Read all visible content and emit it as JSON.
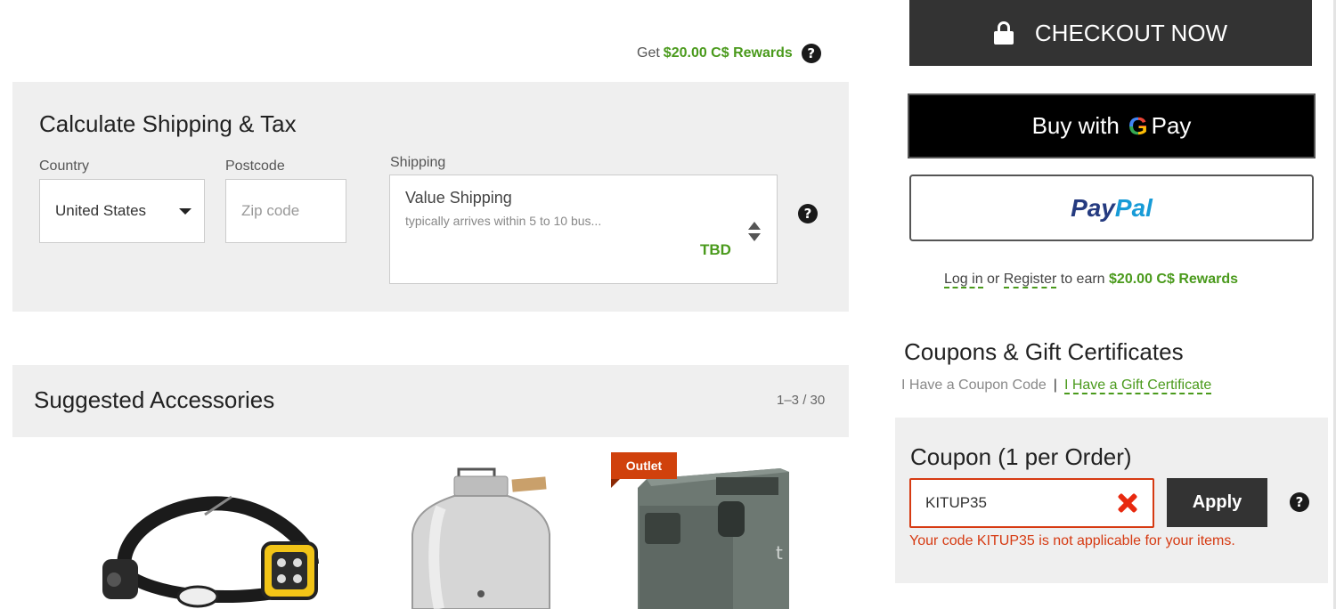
{
  "rewards": {
    "prefix": "Get",
    "amount": "$20.00 C$ Rewards"
  },
  "shipping_calc": {
    "title": "Calculate Shipping & Tax",
    "country_label": "Country",
    "country_value": "United States",
    "postcode_label": "Postcode",
    "postcode_placeholder": "Zip code",
    "shipping_label": "Shipping",
    "shipping_method": "Value Shipping",
    "shipping_desc": "typically arrives within 5 to 10 bus...",
    "shipping_price": "TBD"
  },
  "accessories": {
    "title": "Suggested Accessories",
    "count": "1–3 / 30",
    "outlet_badge": "Outlet"
  },
  "checkout": {
    "checkout_label": "CHECKOUT NOW",
    "gpay_prefix": "Buy with",
    "gpay_g": "G",
    "gpay_suffix": "Pay",
    "paypal_part1": "Pay",
    "paypal_part2": "Pal",
    "login_link": "Log in",
    "or_text": "or",
    "register_link": "Register",
    "earn_text": "to earn",
    "earn_amount": "$20.00 C$ Rewards"
  },
  "coupons": {
    "title": "Coupons & Gift Certificates",
    "coupon_link": "I Have a Coupon Code",
    "separator": "|",
    "gift_link": "I Have a Gift Certificate",
    "panel_title": "Coupon (1 per Order)",
    "code_value": "KITUP35",
    "apply_label": "Apply",
    "error": "Your code KITUP35 is not applicable for your items."
  },
  "icons": {
    "help": "?"
  },
  "colors": {
    "green": "#4a9a1c",
    "error": "#d63a12",
    "dark_button": "#333333",
    "panel_bg": "#efefef"
  }
}
